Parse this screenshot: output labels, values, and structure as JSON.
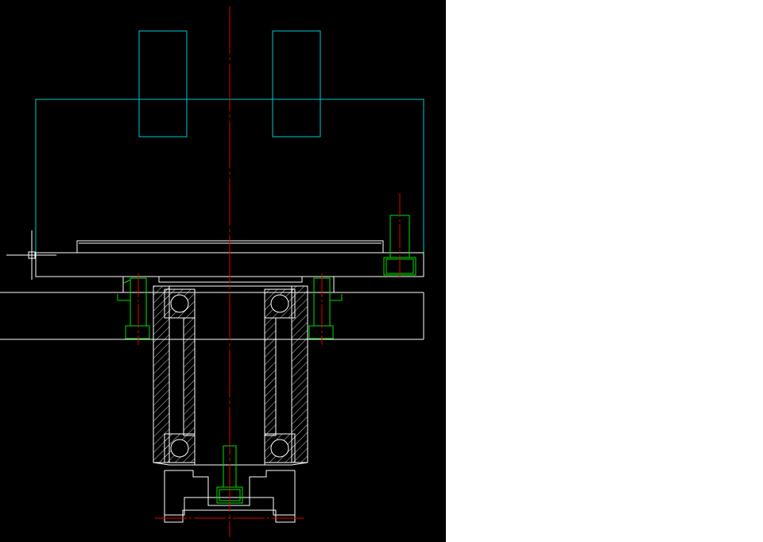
{
  "viewport": {
    "background": "#000000"
  },
  "colors": {
    "outline": "#ffffff",
    "hidden_body": "#00c8d2",
    "fastener": "#00e000",
    "centerline": "#e00000"
  },
  "icons": {
    "cursor": "crosshair-pickbox-icon"
  },
  "blank_panel": {
    "background": "#ffffff"
  }
}
